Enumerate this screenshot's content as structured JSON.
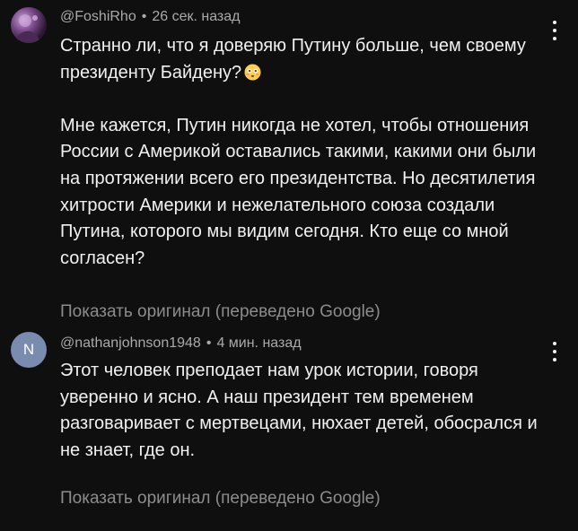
{
  "comments": [
    {
      "author": "@FoshiRho",
      "separator": "•",
      "time": "26 сек. назад",
      "paragraphs": [
        "Странно ли, что я доверяю Путину больше, чем своему президенту Байдену?",
        "Мне кажется, Путин никогда не хотел, чтобы отношения России с Америкой оставались такими, какими они были на протяжении всего его президентства. Но десятилетия хитрости Америки и нежелательного союза создали Путина, которого мы видим сегодня. Кто еще со мной согласен?"
      ],
      "emoji": "flushed-face-emoji",
      "show_original": "Показать оригинал (переведено Google)"
    },
    {
      "author": "@nathanjohnson1948",
      "avatar_letter": "N",
      "avatar_color": "#7a8bb0",
      "separator": "•",
      "time": "4 мин. назад",
      "paragraphs": [
        "Этот человек преподает нам урок истории, говоря уверенно и ясно. А наш президент тем временем разговаривает с мертвецами, нюхает детей, обосрался и не знает, где он."
      ],
      "show_original": "Показать оригинал (переведено Google)"
    }
  ],
  "colors": {
    "background": "#0f0f0f",
    "text_primary": "#f1f1f1",
    "text_secondary": "#aaaaaa",
    "link_muted": "#8c8c8c"
  }
}
